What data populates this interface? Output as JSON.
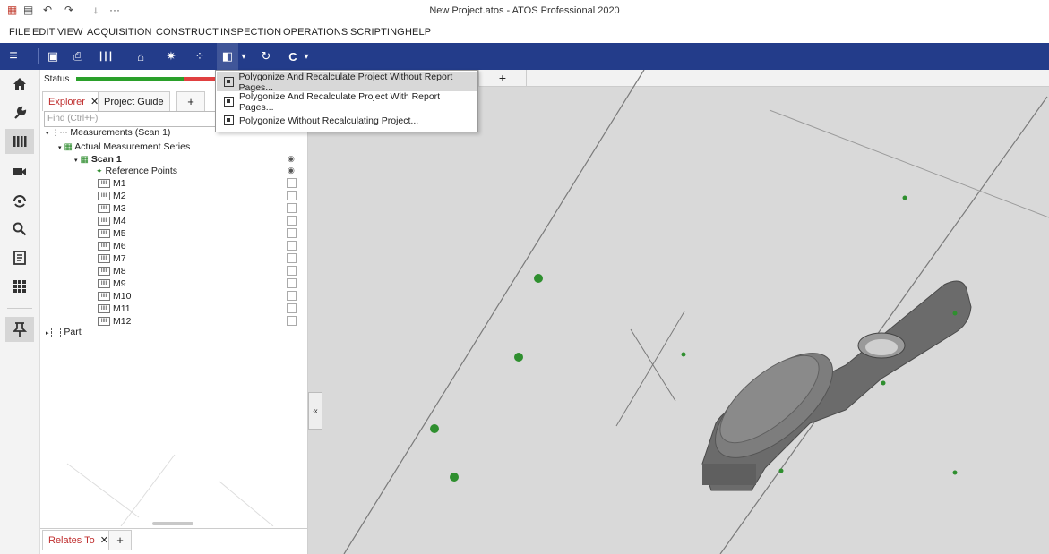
{
  "window": {
    "title": "New Project.atos - ATOS Professional 2020"
  },
  "quick_access": [
    "▦",
    "▤",
    "↶",
    "↷",
    "↓",
    "···"
  ],
  "menu": [
    "FILE",
    "EDIT",
    "VIEW",
    "ACQUISITION",
    "CONSTRUCT",
    "INSPECTION",
    "OPERATIONS",
    "SCRIPTING",
    "HELP"
  ],
  "toolbar": {
    "menu_icon": "≡",
    "icons": [
      "▣",
      "⎙",
      "┃┃┃",
      "⌂",
      "✷",
      "⁘",
      "◧",
      "▾",
      "↻",
      "C",
      "▾"
    ]
  },
  "leftbar": [
    "home-icon",
    "wrench-icon",
    "measurements-icon",
    "camera-icon",
    "sensor-icon",
    "search-icon",
    "report-icon",
    "grid-icon",
    "pin-icon"
  ],
  "panel": {
    "status_label": "Status",
    "tabs": {
      "explorer": "Explorer",
      "close": "✕",
      "project_guide": "Project Guide",
      "add": "+"
    },
    "find_placeholder": "Find (Ctrl+F)",
    "tree": {
      "measurements": "Measurements (Scan 1)",
      "series": "Actual Measurement Series",
      "scan": "Scan 1",
      "ref_points": "Reference Points",
      "items": [
        "M1",
        "M2",
        "M3",
        "M4",
        "M5",
        "M6",
        "M7",
        "M8",
        "M9",
        "M10",
        "M11",
        "M12"
      ],
      "part": "Part"
    },
    "bottom_tabs": {
      "relates_to": "Relates To",
      "close": "✕",
      "add": "+"
    }
  },
  "view": {
    "collapse_button": "«",
    "tab_add": "+"
  },
  "dropdown": {
    "items": [
      "Polygonize And Recalculate Project Without Report Pages...",
      "Polygonize And Recalculate Project With Report Pages...",
      "Polygonize Without Recalculating Project..."
    ],
    "highlighted_index": 0
  },
  "colors": {
    "toolbar": "#233c8a",
    "status_green": "#2aa02a",
    "status_red": "#e04040",
    "scan_part": "#6b6b6b",
    "ref_point": "#2f8f2f"
  }
}
